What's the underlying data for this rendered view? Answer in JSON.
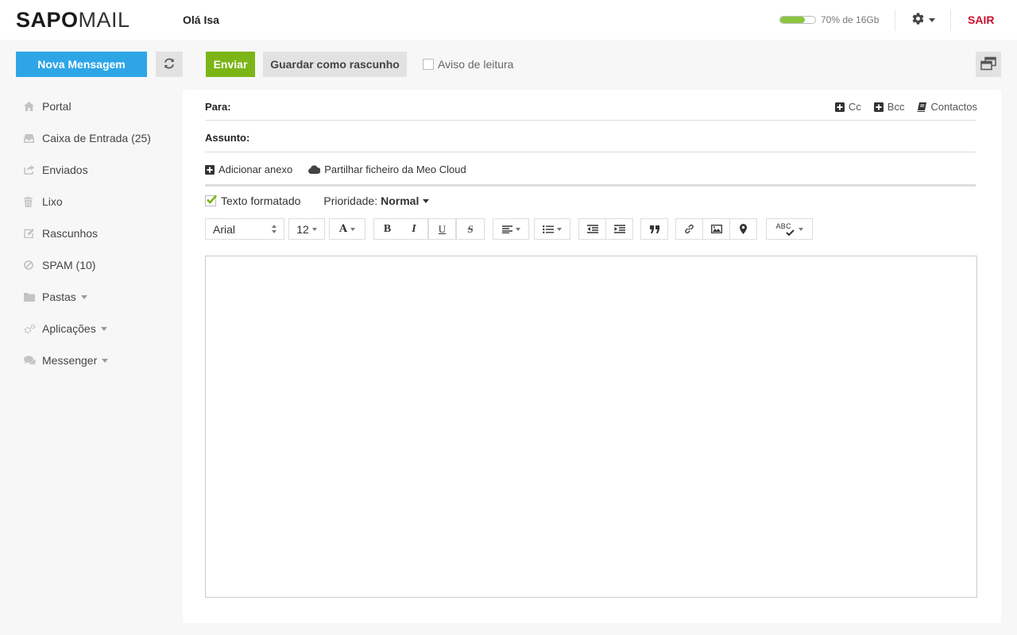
{
  "header": {
    "logo_bold": "SAPO",
    "logo_light": "MAIL",
    "greeting": "Olá Isa",
    "quota_text": "70% de 16Gb",
    "quota_fraction": 0.7,
    "logout": "SAIR"
  },
  "actions": {
    "new_message": "Nova Mensagem",
    "send": "Enviar",
    "save_draft": "Guardar como rascunho",
    "read_receipt": "Aviso de leitura"
  },
  "sidebar": {
    "items": [
      {
        "label": "Portal",
        "icon": "home-icon"
      },
      {
        "label": "Caixa de Entrada (25)",
        "icon": "inbox-icon"
      },
      {
        "label": "Enviados",
        "icon": "sent-icon"
      },
      {
        "label": "Lixo",
        "icon": "trash-icon"
      },
      {
        "label": "Rascunhos",
        "icon": "drafts-icon"
      },
      {
        "label": "SPAM (10)",
        "icon": "spam-icon"
      },
      {
        "label": "Pastas",
        "icon": "folder-icon"
      },
      {
        "label": "Aplicações",
        "icon": "apps-icon"
      },
      {
        "label": "Messenger",
        "icon": "chat-icon"
      }
    ]
  },
  "compose": {
    "to_label": "Para:",
    "cc": "Cc",
    "bcc": "Bcc",
    "contacts": "Contactos",
    "subject_label": "Assunto:",
    "add_attachment": "Adicionar anexo",
    "share_cloud": "Partilhar ficheiro da Meo Cloud",
    "formatted_text": "Texto formatado",
    "formatted_checked": true,
    "priority_label": "Prioridade:",
    "priority_value": "Normal"
  },
  "toolbar": {
    "font_family": "Arial",
    "font_size": "12",
    "font_color_glyph": "A",
    "bold": "B",
    "italic": "I",
    "underline": "U",
    "strike": "S",
    "spell_glyph": "ABC"
  },
  "colors": {
    "accent_blue": "#2ea6e6",
    "send_green": "#7cb518",
    "logout_red": "#c8102e",
    "quota_green": "#8cc63f"
  }
}
